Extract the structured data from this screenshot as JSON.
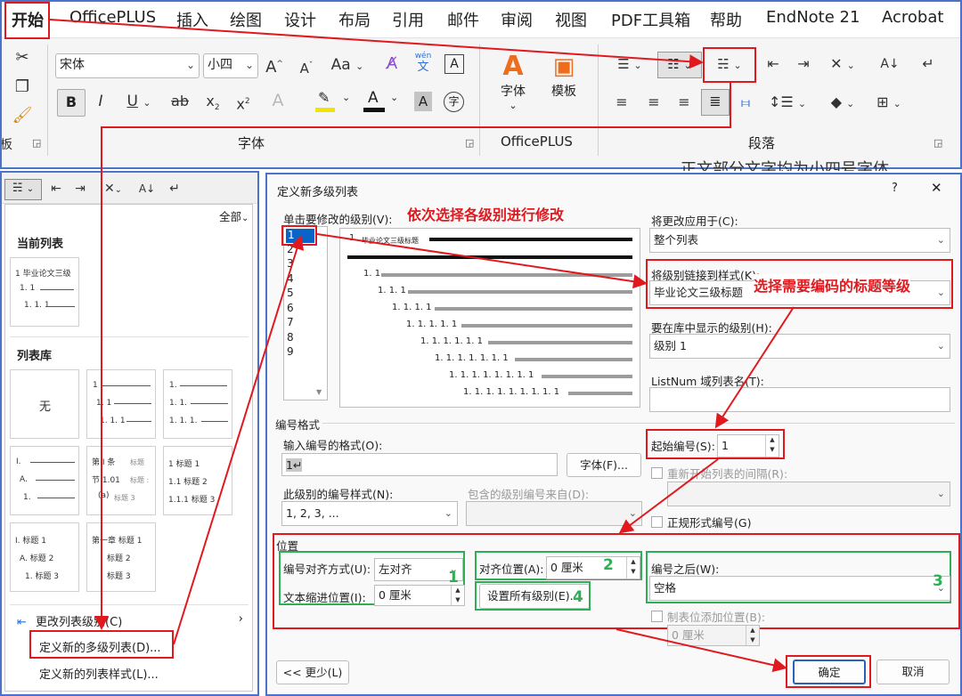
{
  "ribbon": {
    "tabs": [
      "开始",
      "OfficePLUS",
      "插入",
      "绘图",
      "设计",
      "布局",
      "引用",
      "邮件",
      "审阅",
      "视图",
      "PDF工具箱",
      "帮助",
      "EndNote 21",
      "Acrobat"
    ],
    "font_name": "宋体",
    "font_size": "小四",
    "font_group": "字体",
    "officeplus_group": "OfficePLUS",
    "paragraph_group": "段落",
    "font_btn": "字体",
    "template_btn": "模板",
    "bold": "B",
    "italic": "I",
    "underline": "U",
    "strike": "ab",
    "sub": "x",
    "sup": "x",
    "sub_mark": "2",
    "sup_mark": "2",
    "aa": "Aa",
    "wen_pinyin": "wén",
    "wen_char": "文",
    "box_a": "A",
    "zi": "字",
    "grow": "A",
    "shrink": "A",
    "highlight_a": "A",
    "fontcolor_a": "A",
    "shade_a": "A",
    "sort": "A↓",
    "clip_left": "板"
  },
  "behind_text": "正文部分文字均为小四号字体",
  "dropdown": {
    "all": "全部",
    "current_list": "当前列表",
    "current_thumb": [
      "1 毕业论文三级",
      "1. 1",
      "1. 1. 1"
    ],
    "library": "列表库",
    "none": "无",
    "thumb2": [
      "1",
      "1. 1",
      "1. 1. 1"
    ],
    "thumb3": [
      "1.",
      "1. 1.",
      "1. 1. 1."
    ],
    "thumb4": [
      "I.",
      "A.",
      "1."
    ],
    "thumb5_a": "第 I 条",
    "thumb5_b": "节 1.01",
    "thumb5_c": "(a)",
    "thumb5_tags": [
      "标题",
      "标题 :",
      "标题 3"
    ],
    "thumb6": [
      "1 标题 1",
      "1.1 标题 2",
      "1.1.1 标题 3"
    ],
    "thumb7": [
      "I. 标题 1",
      "A. 标题 2",
      "1. 标题 3"
    ],
    "thumb8": [
      "第一章 标题 1",
      "标题 2",
      "标题 3"
    ],
    "change_level": "更改列表级别(C)",
    "define_multilevel": "定义新的多级列表(D)...",
    "define_style": "定义新的列表样式(L)..."
  },
  "dialog": {
    "title": "定义新多级列表",
    "help": "?",
    "close": "✕",
    "select_level_label": "单击要修改的级别(V):",
    "levels": [
      "1",
      "2",
      "3",
      "4",
      "5",
      "6",
      "7",
      "8",
      "9"
    ],
    "preview_first": "1",
    "preview_first_label": "毕业论文三级标题",
    "preview_rows": [
      "1. 1",
      "1. 1. 1",
      "1. 1. 1. 1",
      "1. 1. 1. 1. 1",
      "1. 1. 1. 1. 1. 1",
      "1. 1. 1. 1. 1. 1. 1",
      "1. 1. 1. 1. 1. 1. 1. 1",
      "1. 1. 1. 1. 1. 1. 1. 1. 1"
    ],
    "apply_to_label": "将更改应用于(C):",
    "apply_to_value": "整个列表",
    "link_style_label": "将级别链接到样式(K):",
    "link_style_value": "毕业论文三级标题",
    "gallery_level_label": "要在库中显示的级别(H):",
    "gallery_level_value": "级别 1",
    "listnum_label": "ListNum 域列表名(T):",
    "number_format_section": "编号格式",
    "enter_format_label": "输入编号的格式(O):",
    "enter_format_value": "1↵",
    "font_button": "字体(F)...",
    "style_label": "此级别的编号样式(N):",
    "style_value": "1, 2, 3, ...",
    "include_from_label": "包含的级别编号来自(D):",
    "start_at_label": "起始编号(S):",
    "start_at_value": "1",
    "restart_label": "重新开始列表的间隔(R):",
    "legal_label": "正规形式编号(G)",
    "position_section": "位置",
    "alignment_label": "编号对齐方式(U):",
    "alignment_value": "左对齐",
    "align_at_label": "对齐位置(A):",
    "align_at_value": "0 厘米",
    "indent_label": "文本缩进位置(I):",
    "indent_value": "0 厘米",
    "set_all_button": "设置所有级别(E)...",
    "follow_label": "编号之后(W):",
    "follow_value": "空格",
    "tab_stop_label": "制表位添加位置(B):",
    "tab_stop_value": "0 厘米",
    "less_button": "<< 更少(L)",
    "ok_button": "确定",
    "cancel_button": "取消"
  },
  "annotations": {
    "pick_levels": "依次选择各级别进行修改",
    "pick_heading": "选择需要编码的标题等级",
    "n1": "1",
    "n2": "2",
    "n3": "3",
    "n4": "4"
  }
}
